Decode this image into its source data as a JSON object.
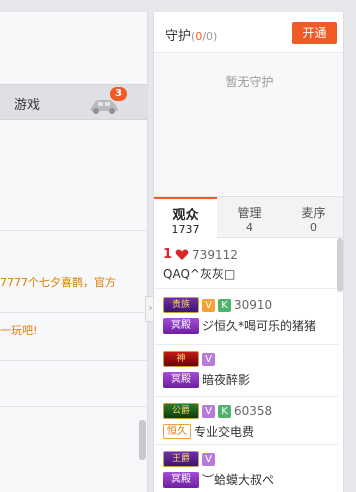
{
  "left": {
    "tab_game": "游戏",
    "car_badge": "3",
    "chat_lines": [
      "7777个七夕喜鹊，官方",
      "一玩吧!"
    ]
  },
  "guard": {
    "title": "守护",
    "count_current": "0",
    "count_total": "/0",
    "open_button": "开通",
    "empty_text": "暂无守护"
  },
  "tabs": [
    {
      "label": "观众",
      "count": "1737"
    },
    {
      "label": "管理",
      "count": "4"
    },
    {
      "label": "麦序",
      "count": "0"
    }
  ],
  "viewers": [
    {
      "rank": "1",
      "id": "739112",
      "name": "QAQ^灰灰□"
    },
    {
      "noble": "贵族",
      "vip": "V",
      "k": "K",
      "id": "30910",
      "rank_tag": "冥殿",
      "name": "ジ恒久*喝可乐的猪猪"
    },
    {
      "noble": "神",
      "vip": "V",
      "rank_tag": "冥殿",
      "name": "暗夜醉影"
    },
    {
      "noble": "公爵",
      "vip": "V",
      "k": "K",
      "id": "60358",
      "fan_tag": "恒久",
      "name": "专业交电费"
    },
    {
      "noble": "王爵",
      "vip": "V",
      "rank_tag": "冥殿",
      "name": "︶蛤蟆大叔ぺ"
    }
  ],
  "colors": {
    "accent": "#f05a24"
  }
}
